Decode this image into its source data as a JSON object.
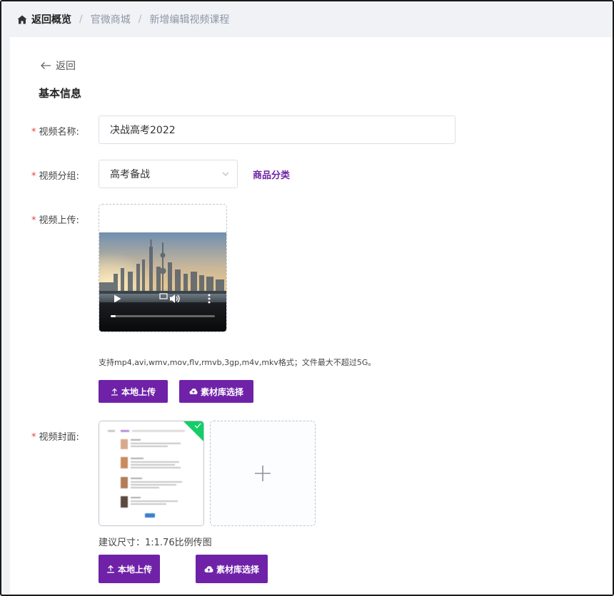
{
  "breadcrumb": {
    "home_label": "返回概览",
    "items": [
      "官微商城",
      "新增编辑视频课程"
    ]
  },
  "back_label": "返回",
  "section_title": "基本信息",
  "form": {
    "required_mark": "*",
    "video_name": {
      "label": "视频名称:",
      "value": "决战高考2022"
    },
    "video_group": {
      "label": "视频分组:",
      "value": "高考备战",
      "link": "商品分类"
    },
    "video_upload": {
      "label": "视频上传:",
      "hint": "支持mp4,avi,wmv,mov,flv,rmvb,3gp,m4v,mkv格式；文件最大不超过5G。",
      "progress": 0.05,
      "local_button": "本地上传",
      "library_button": "素材库选择"
    },
    "video_cover": {
      "label": "视频封面:",
      "size_hint": "建议尺寸：1:1.76比例传图",
      "local_button": "本地上传",
      "library_button": "素材库选择"
    }
  },
  "colors": {
    "accent": "#6f22a8",
    "required": "#e64242",
    "success": "#13ce66",
    "breadcrumb_bg": "#f0f2f5"
  },
  "icons": {
    "home": "home-icon",
    "back": "arrow-left-icon",
    "chevron": "chevron-down-icon",
    "upload": "upload-icon",
    "cloud": "cloud-upload-icon",
    "plus": "plus-icon",
    "check": "check-icon",
    "play": "play-icon",
    "volume": "volume-icon",
    "more": "more-vertical-icon"
  }
}
